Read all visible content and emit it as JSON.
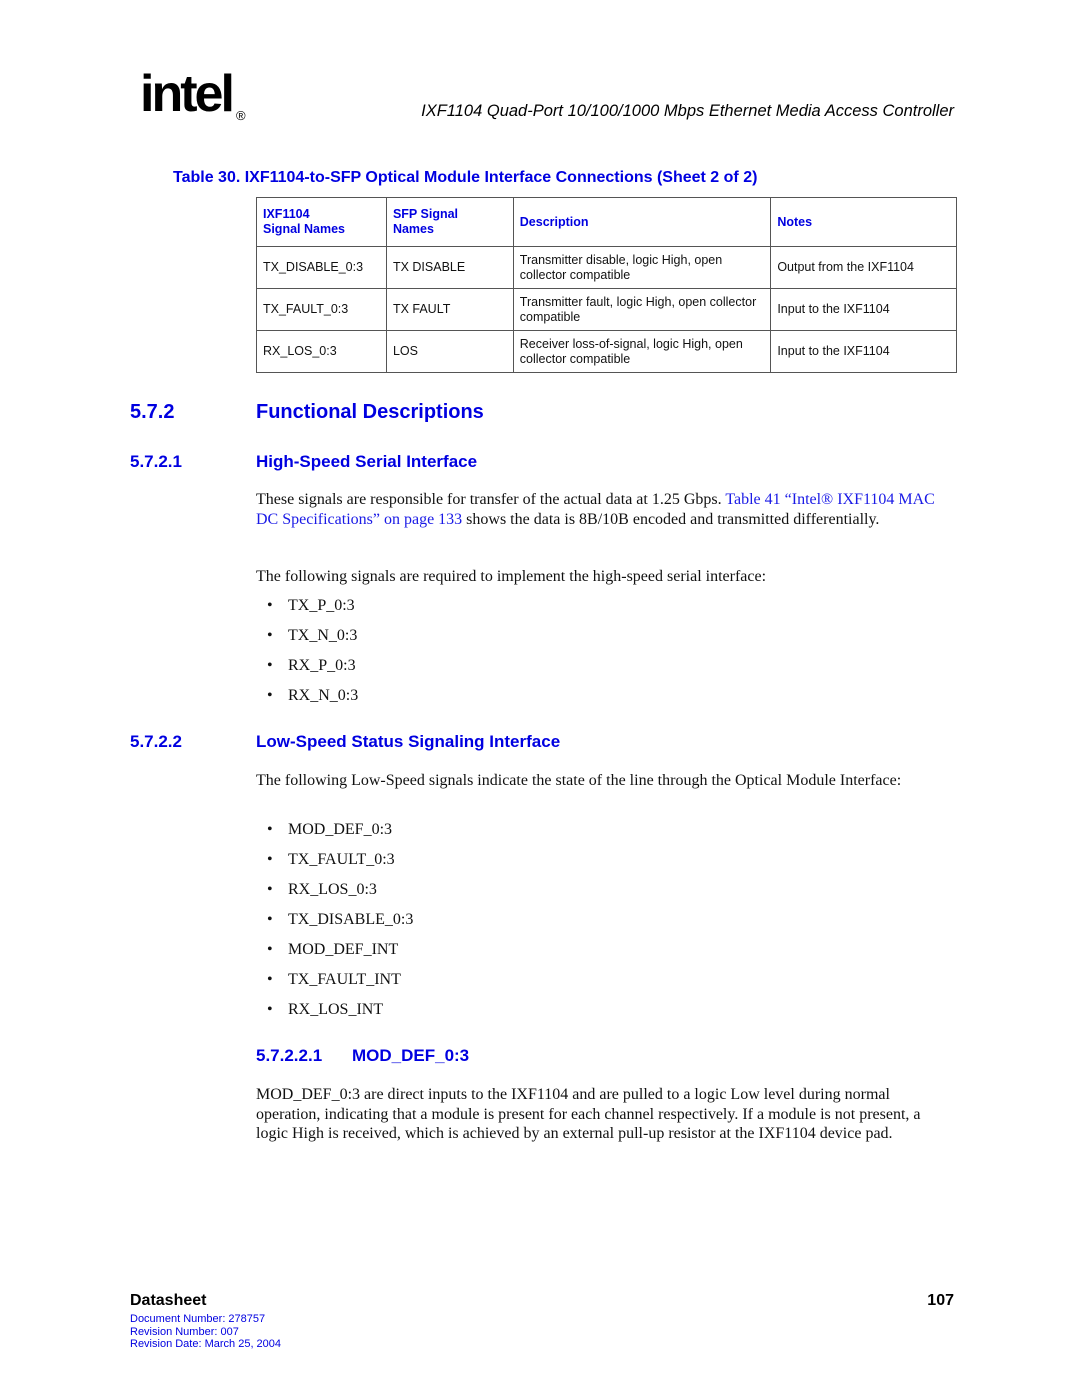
{
  "header": {
    "logo_text": "intel",
    "logo_reg": "®",
    "doc_title": "IXF1104 Quad-Port 10/100/1000 Mbps Ethernet Media Access Controller"
  },
  "table": {
    "caption": "Table 30.  IXF1104-to-SFP Optical Module Interface Connections (Sheet 2 of 2)",
    "headers": [
      {
        "line1": "IXF1104",
        "line2": "Signal Names"
      },
      {
        "line1": "SFP Signal",
        "line2": "Names"
      },
      {
        "line1": "Description",
        "line2": ""
      },
      {
        "line1": "Notes",
        "line2": ""
      }
    ],
    "rows": [
      [
        "TX_DISABLE_0:3",
        "TX DISABLE",
        "Transmitter disable, logic High, open collector compatible",
        "Output from the IXF1104"
      ],
      [
        "TX_FAULT_0:3",
        "TX FAULT",
        "Transmitter fault, logic High, open collector compatible",
        "Input to the IXF1104"
      ],
      [
        "RX_LOS_0:3",
        "LOS",
        "Receiver loss-of-signal, logic High, open collector compatible",
        "Input to the IXF1104"
      ]
    ]
  },
  "sections": {
    "s572": {
      "num": "5.7.2",
      "title": "Functional Descriptions"
    },
    "s5721": {
      "num": "5.7.2.1",
      "title": "High-Speed Serial Interface",
      "para1_pre": "These signals are responsible for transfer of the actual data at 1.25 Gbps. ",
      "para1_link": "Table 41 “Intel® IXF1104 MAC DC Specifications” on page 133",
      "para1_post": " shows the data is 8B/10B encoded and transmitted differentially.",
      "para2": "The following signals are required to implement the high-speed serial interface:",
      "bullets": [
        "TX_P_0:3",
        "TX_N_0:3",
        "RX_P_0:3",
        "RX_N_0:3"
      ]
    },
    "s5722": {
      "num": "5.7.2.2",
      "title": "Low-Speed Status Signaling Interface",
      "para": "The following Low-Speed signals indicate the state of the line through the Optical Module Interface:",
      "bullets": [
        "MOD_DEF_0:3",
        "TX_FAULT_0:3",
        "RX_LOS_0:3",
        "TX_DISABLE_0:3",
        "MOD_DEF_INT",
        "TX_FAULT_INT",
        "RX_LOS_INT"
      ]
    },
    "s57221": {
      "num": "5.7.2.2.1",
      "title": "MOD_DEF_0:3",
      "para": "MOD_DEF_0:3 are direct inputs to the IXF1104 and are pulled to a logic Low level during normal operation, indicating that a module is present for each channel respectively. If a module is not present, a logic High is received, which is achieved by an external pull-up resistor at the IXF1104 device pad."
    }
  },
  "bullet_glyph": "•",
  "footer": {
    "title": "Datasheet",
    "page": "107",
    "doc_number": "Document Number: 278757",
    "revision_number": "Revision Number: 007",
    "revision_date": "Revision Date: March 25, 2004"
  }
}
